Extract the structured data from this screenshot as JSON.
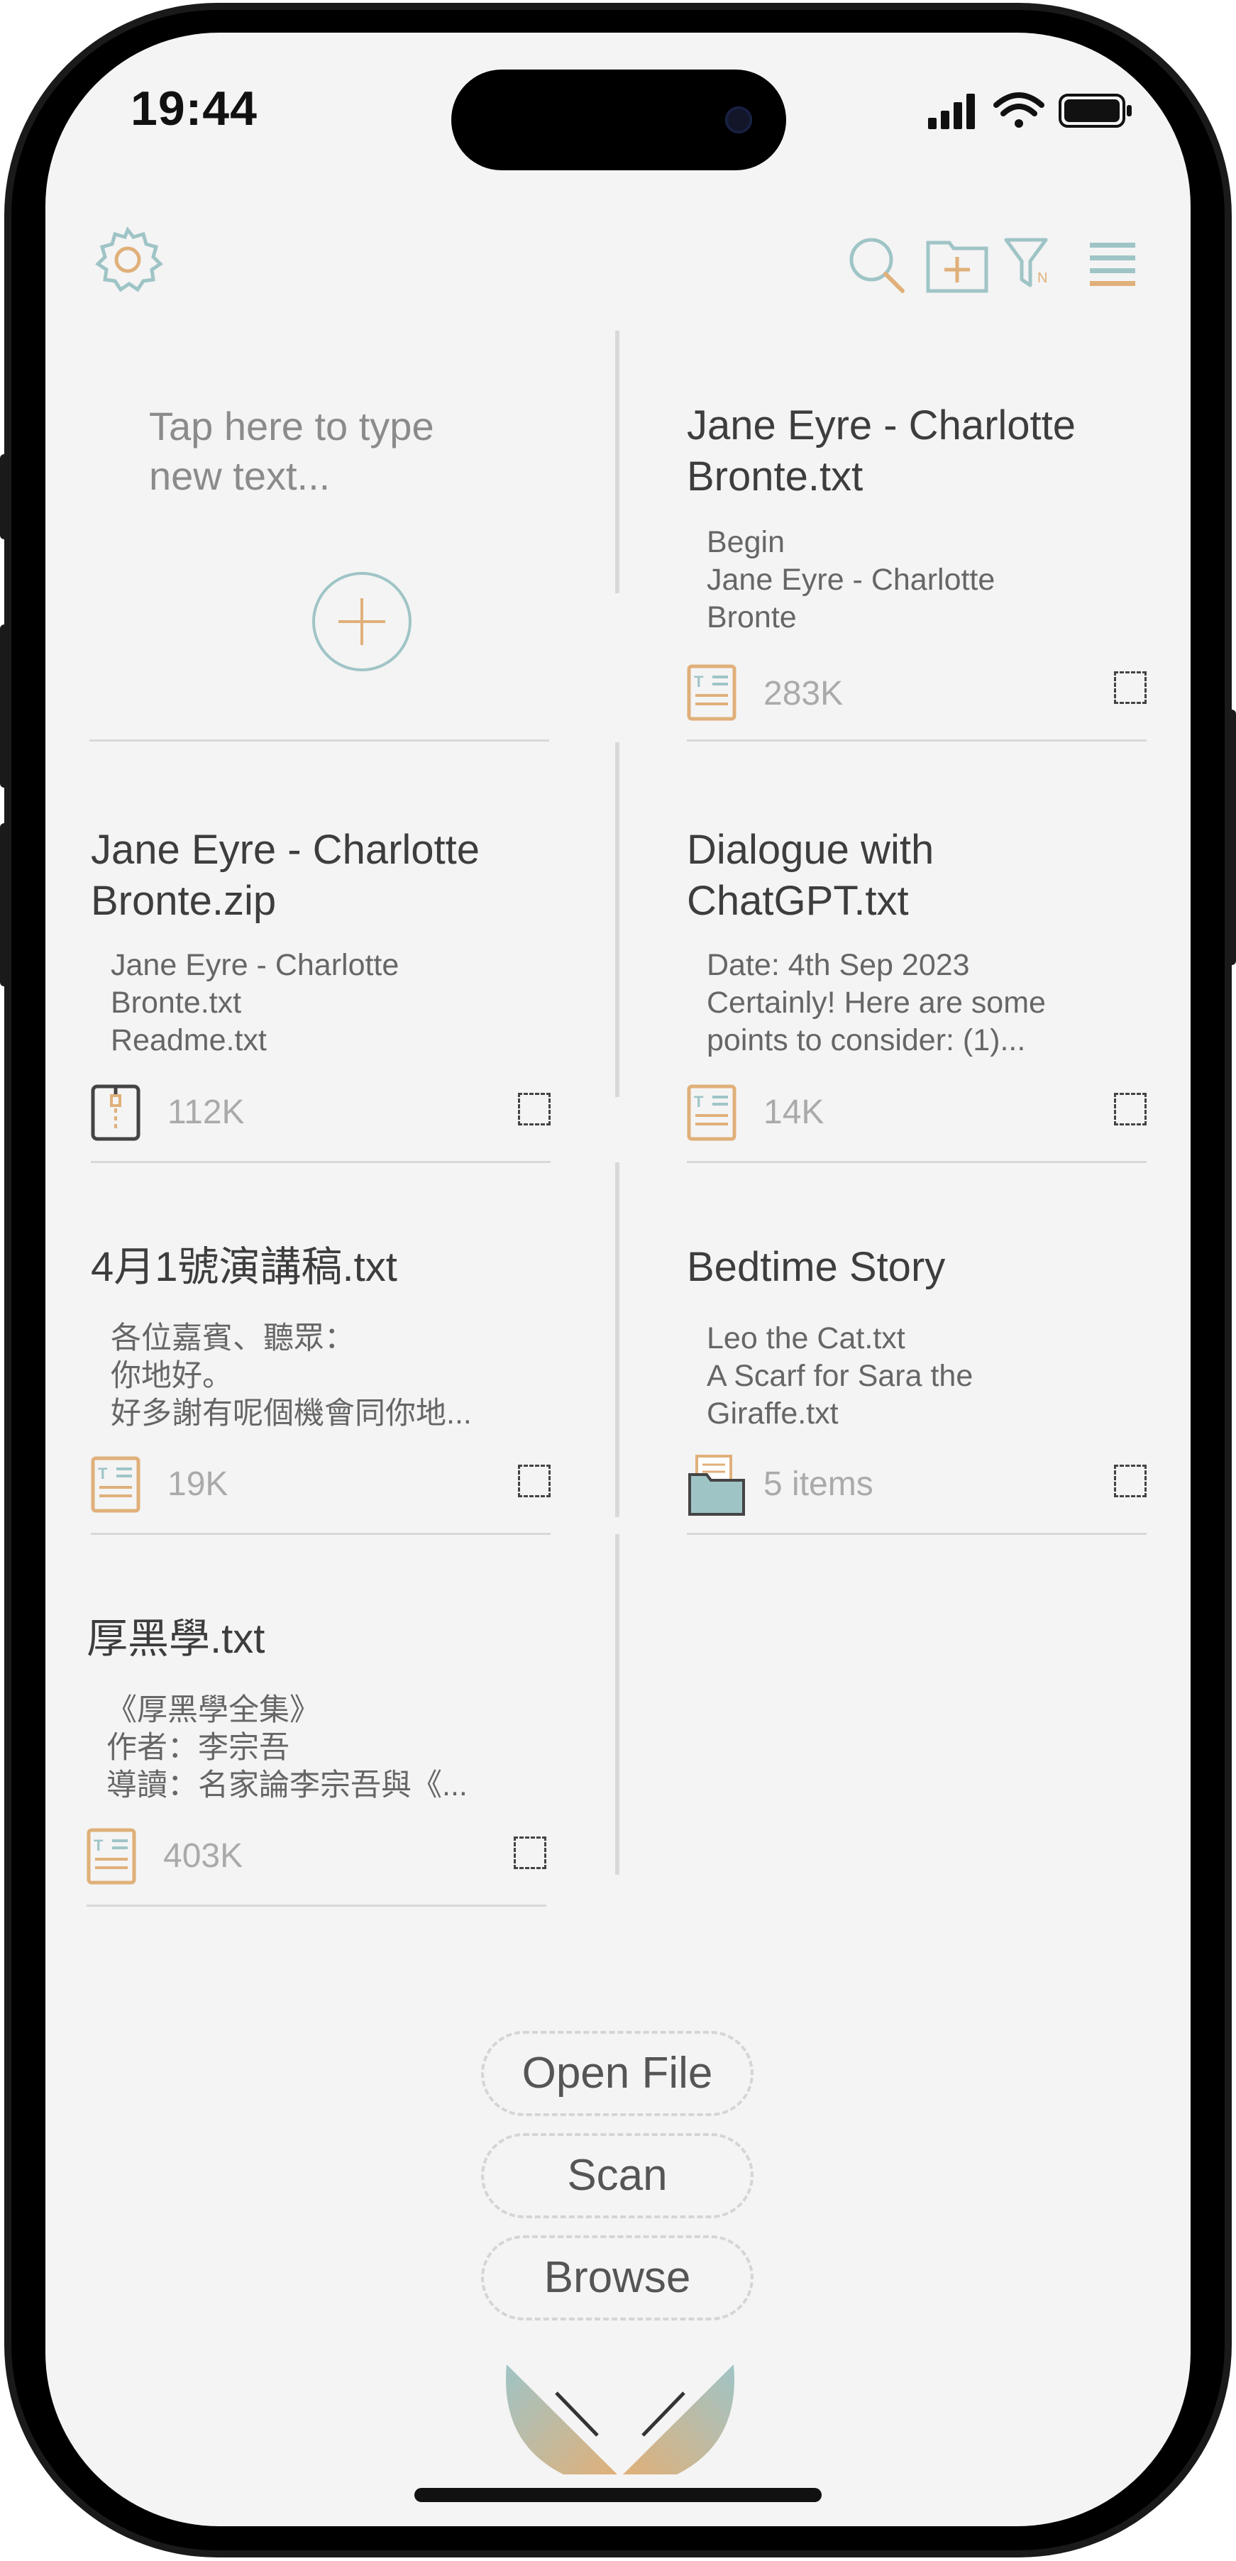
{
  "status_bar": {
    "time": "19:44"
  },
  "toolbar": {
    "settings_icon": "gear-icon",
    "search_icon": "search-icon",
    "new_folder_icon": "folder-plus-icon",
    "filter_icon": "filter-icon",
    "menu_icon": "menu-icon"
  },
  "new_text_card": {
    "placeholder": "Tap here to type new text..."
  },
  "files": [
    {
      "title": "Jane Eyre - Charlotte Bronte.txt",
      "preview": "Begin\nJane Eyre - Charlotte\nBronte",
      "size": "283K",
      "icon": "text-file-icon"
    },
    {
      "title": "Jane Eyre - Charlotte Bronte.zip",
      "preview": "Jane Eyre - Charlotte\nBronte.txt\nReadme.txt",
      "size": "112K",
      "icon": "zip-file-icon"
    },
    {
      "title": "Dialogue with ChatGPT.txt",
      "preview": "Date: 4th Sep 2023\nCertainly! Here are some\npoints to consider: (1)...",
      "size": "14K",
      "icon": "text-file-icon"
    },
    {
      "title": "4月1號演講稿.txt",
      "preview": "各位嘉賓、聽眾：\n你地好。\n好多謝有呢個機會同你地...",
      "size": "19K",
      "icon": "text-file-icon"
    },
    {
      "title": "Bedtime Story",
      "preview": "Leo the Cat.txt\nA Scarf for Sara the\nGiraffe.txt",
      "size": "5 items",
      "icon": "folder-icon"
    },
    {
      "title": "厚黑學.txt",
      "preview": "《厚黑學全集》\n作者：李宗吾\n導讀：名家論李宗吾與《...",
      "size": "403K",
      "icon": "text-file-icon"
    }
  ],
  "actions": {
    "open_file": "Open File",
    "scan": "Scan",
    "browse": "Browse"
  },
  "colors": {
    "accent_teal": "#9fc4c6",
    "accent_gold": "#e0b07a",
    "background": "#f4f4f4"
  }
}
